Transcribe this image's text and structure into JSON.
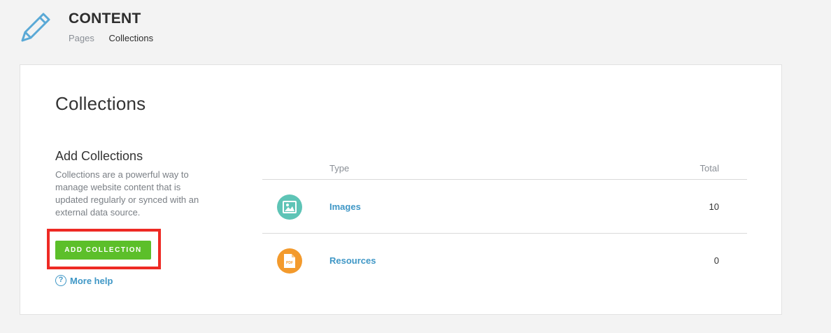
{
  "header": {
    "title": "CONTENT",
    "nav": [
      {
        "label": "Pages",
        "active": false
      },
      {
        "label": "Collections",
        "active": true
      }
    ],
    "icon": "pencil-icon",
    "accent_color": "#5aa9d6"
  },
  "main": {
    "title": "Collections",
    "add": {
      "title": "Add Collections",
      "description": "Collections are a powerful way to manage website content that is updated regularly or synced with an external data source.",
      "button_label": "ADD COLLECTION",
      "button_color": "#5cbf2a",
      "highlight_color": "#ee2a24",
      "help_label": "More help",
      "help_icon": "question-circle-icon"
    },
    "table": {
      "columns": {
        "type": "Type",
        "total": "Total"
      },
      "rows": [
        {
          "name": "Images",
          "total": "10",
          "icon": "image-icon",
          "icon_color": "#5ec4b6"
        },
        {
          "name": "Resources",
          "total": "0",
          "icon": "pdf-file-icon",
          "icon_color": "#f39a2c",
          "icon_text": "PDF"
        }
      ]
    }
  }
}
